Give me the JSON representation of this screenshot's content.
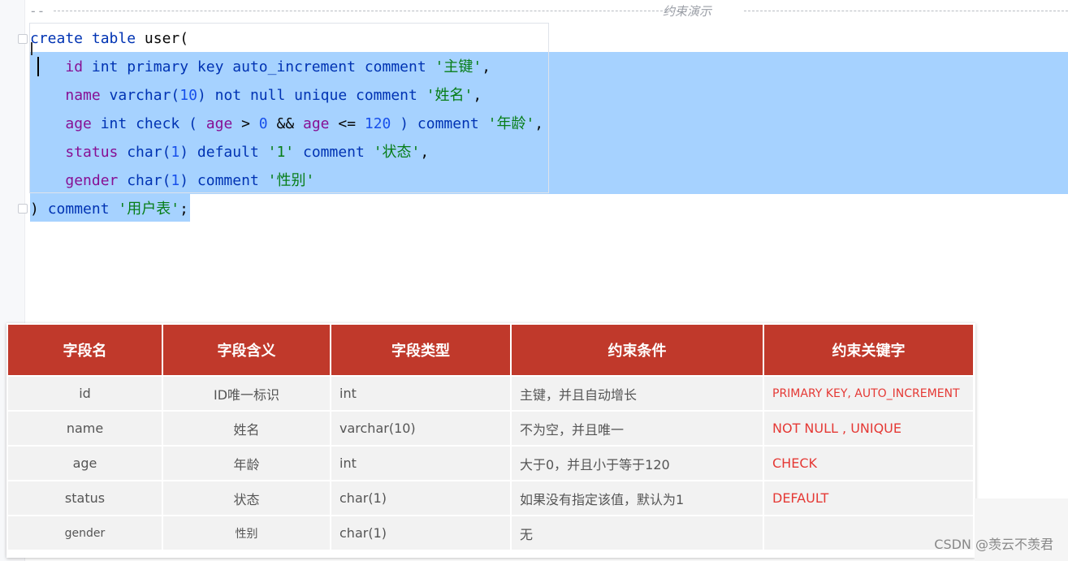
{
  "editor": {
    "banner_prefix": "--",
    "banner_title": "约束演示"
  },
  "code_lines": [
    [
      {
        "t": "create table ",
        "c": "kw"
      },
      {
        "t": "user(",
        "c": "plain"
      }
    ],
    [
      {
        "t": "    ",
        "c": "plain"
      },
      {
        "t": "id ",
        "c": "ident"
      },
      {
        "t": "int primary key auto_increment comment ",
        "c": "kw"
      },
      {
        "t": "'主键'",
        "c": "str"
      },
      {
        "t": ",",
        "c": "plain"
      }
    ],
    [
      {
        "t": "    ",
        "c": "plain"
      },
      {
        "t": "name ",
        "c": "ident"
      },
      {
        "t": "varchar(",
        "c": "kw"
      },
      {
        "t": "10",
        "c": "num"
      },
      {
        "t": ") not null unique comment ",
        "c": "kw"
      },
      {
        "t": "'姓名'",
        "c": "str"
      },
      {
        "t": ",",
        "c": "plain"
      }
    ],
    [
      {
        "t": "    ",
        "c": "plain"
      },
      {
        "t": "age ",
        "c": "ident"
      },
      {
        "t": "int check ( ",
        "c": "kw"
      },
      {
        "t": "age",
        "c": "ident"
      },
      {
        "t": " > ",
        "c": "plain"
      },
      {
        "t": "0",
        "c": "num"
      },
      {
        "t": " && ",
        "c": "plain"
      },
      {
        "t": "age",
        "c": "ident"
      },
      {
        "t": " <= ",
        "c": "plain"
      },
      {
        "t": "120",
        "c": "num"
      },
      {
        "t": " ) comment ",
        "c": "kw"
      },
      {
        "t": "'年龄'",
        "c": "str"
      },
      {
        "t": ",",
        "c": "plain"
      }
    ],
    [
      {
        "t": "    ",
        "c": "plain"
      },
      {
        "t": "status ",
        "c": "ident"
      },
      {
        "t": "char(",
        "c": "kw"
      },
      {
        "t": "1",
        "c": "num"
      },
      {
        "t": ") default ",
        "c": "kw"
      },
      {
        "t": "'1'",
        "c": "str"
      },
      {
        "t": " comment ",
        "c": "kw"
      },
      {
        "t": "'状态'",
        "c": "str"
      },
      {
        "t": ",",
        "c": "plain"
      }
    ],
    [
      {
        "t": "    ",
        "c": "plain"
      },
      {
        "t": "gender ",
        "c": "ident"
      },
      {
        "t": "char(",
        "c": "kw"
      },
      {
        "t": "1",
        "c": "num"
      },
      {
        "t": ") comment ",
        "c": "kw"
      },
      {
        "t": "'性别'",
        "c": "str"
      }
    ],
    [
      {
        "t": ") ",
        "c": "plain"
      },
      {
        "t": "comment ",
        "c": "kw"
      },
      {
        "t": "'用户表'",
        "c": "str"
      },
      {
        "t": ";",
        "c": "plain"
      }
    ]
  ],
  "table": {
    "headers": [
      "字段名",
      "字段含义",
      "字段类型",
      "约束条件",
      "约束关键字"
    ],
    "rows": [
      [
        "id",
        "ID唯一标识",
        "int",
        "主键，并且自动增长",
        "PRIMARY KEY, AUTO_INCREMENT"
      ],
      [
        "name",
        "姓名",
        "varchar(10)",
        "不为空，并且唯一",
        "NOT NULL , UNIQUE"
      ],
      [
        "age",
        "年龄",
        "int",
        "大于0，并且小于等于120",
        "CHECK"
      ],
      [
        "status",
        "状态",
        "char(1)",
        "如果没有指定该值，默认为1",
        "DEFAULT"
      ],
      [
        "gender",
        "性别",
        "char(1)",
        "无",
        ""
      ]
    ]
  },
  "watermark": "CSDN @羡云不羡君",
  "colors": {
    "header_bg": "#c0392b",
    "selection": "#a6d2ff",
    "keyword_red": "#e53935"
  }
}
